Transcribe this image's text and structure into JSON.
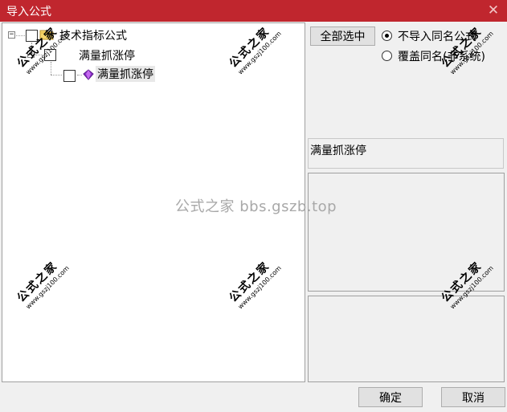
{
  "window": {
    "title": "导入公式",
    "close_glyph": "✕"
  },
  "tree": {
    "root": {
      "label": "技术指标公式",
      "expander": "−",
      "icon": "folder-icon"
    },
    "group": {
      "label": "满量抓涨停",
      "expander": "−"
    },
    "leaf": {
      "label": "满量抓涨停",
      "icon": "formula-gem-icon"
    }
  },
  "options": {
    "select_all_label": "全部选中",
    "radio_skip_label": "不导入同名公式",
    "radio_overwrite_label": "覆盖同名(非系统)",
    "selected": "skip"
  },
  "detail": {
    "formula_name": "满量抓涨停"
  },
  "footer": {
    "ok_label": "确定",
    "cancel_label": "取消"
  },
  "watermark": {
    "center_text": "公式之家 bbs.gszb.top",
    "stamp_title": "公式之家",
    "stamp_url": "www.gszj100.com"
  },
  "colors": {
    "titlebar": "#c0262e",
    "folder": "#f5d66a",
    "gem": "#8a2fc8"
  }
}
